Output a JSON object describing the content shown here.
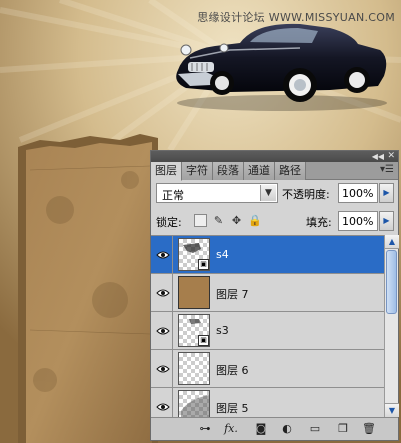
{
  "watermark": "思缘设计论坛 WWW.MISSYUAN.COM",
  "panel": {
    "tabs": [
      {
        "label": "图层",
        "active": true
      },
      {
        "label": "字符",
        "active": false
      },
      {
        "label": "段落",
        "active": false
      },
      {
        "label": "通道",
        "active": false
      },
      {
        "label": "路径",
        "active": false
      }
    ],
    "blend_mode": "正常",
    "opacity_label": "不透明度:",
    "opacity_value": "100%",
    "lock_label": "锁定:",
    "fill_label": "填充:",
    "fill_value": "100%",
    "layers": [
      {
        "name": "s4",
        "selected": true,
        "thumb": "smart-object"
      },
      {
        "name": "图层 7",
        "selected": false,
        "thumb": "paper"
      },
      {
        "name": "s3",
        "selected": false,
        "thumb": "smart-object"
      },
      {
        "name": "图层 6",
        "selected": false,
        "thumb": "transparent"
      },
      {
        "name": "图层 5",
        "selected": false,
        "thumb": "transparent"
      }
    ],
    "footer_icons": [
      "link-icon",
      "fx-icon",
      "mask-icon",
      "adjustment-icon",
      "group-folder-icon",
      "new-layer-icon",
      "trash-icon"
    ]
  },
  "colors": {
    "selection": "#2a6cc6",
    "panel_bg": "#d4d4d4",
    "paper": "#a67e4c"
  }
}
